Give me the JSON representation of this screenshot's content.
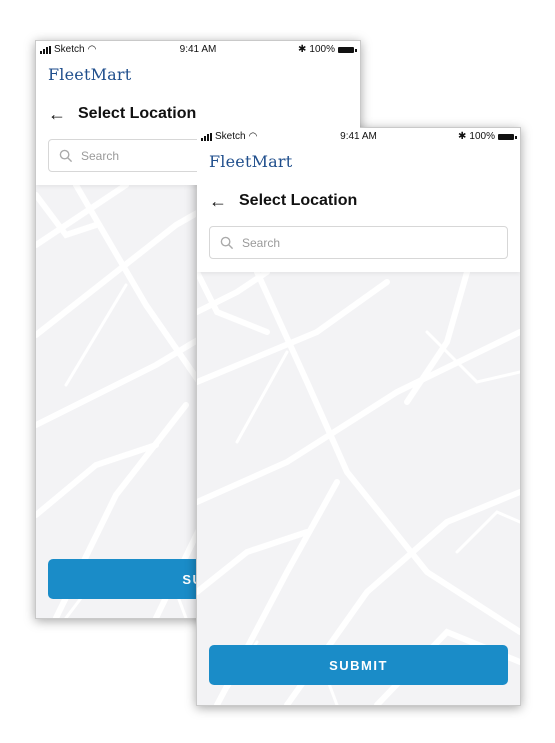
{
  "status_bar": {
    "carrier": "Sketch",
    "time": "9:41 AM",
    "battery": "100%"
  },
  "brand": {
    "logo": "FleetMart"
  },
  "screen": {
    "title": "Select Location",
    "back_icon": "arrow-left-icon"
  },
  "search": {
    "placeholder": "Search"
  },
  "actions": {
    "submit_label": "SUBMIT",
    "submit_back_partial": "SUE"
  },
  "colors": {
    "accent": "#1a8cc8",
    "brand": "#1f4e8c",
    "map_bg": "#f3f3f5"
  }
}
